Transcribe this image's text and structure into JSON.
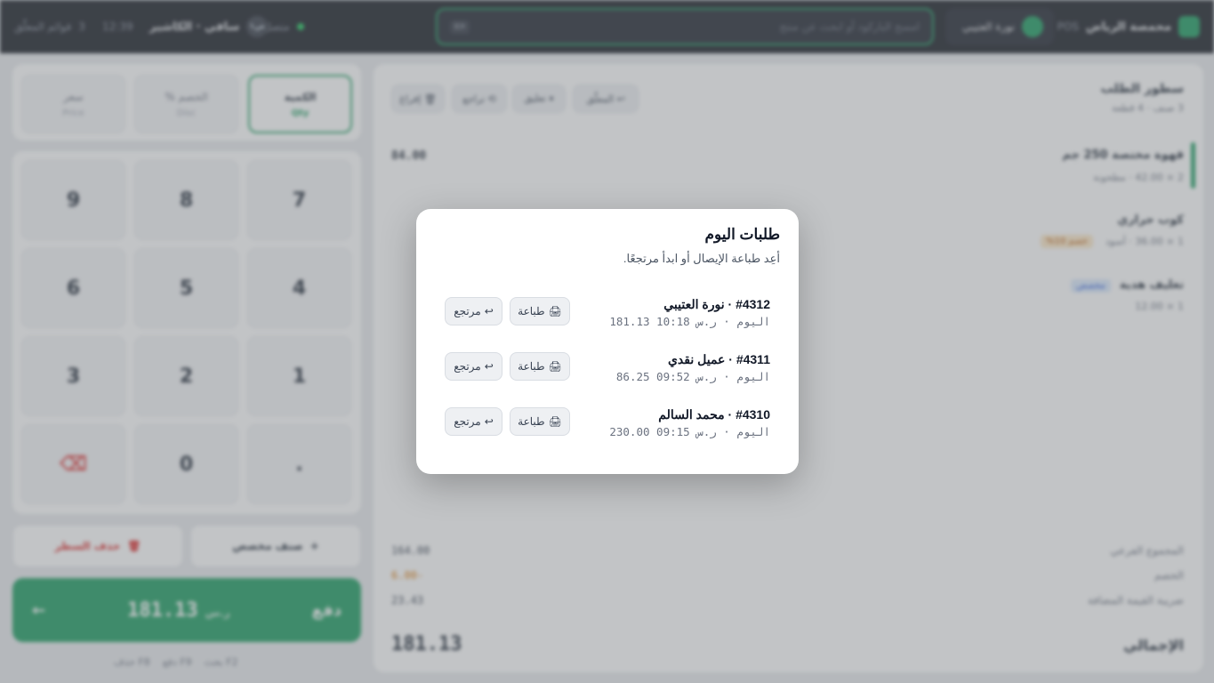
{
  "topbar": {
    "app_name": "محمصة الرياض",
    "badge": "POS",
    "user_name": "نورة العتيبي",
    "search_placeholder": "امسح الباركود أو ابحث عن منتج",
    "search_shortcut": "⌘K",
    "status": "متصل",
    "register": "سافي · الكاشير",
    "register_short": "ص١",
    "time": "12:39",
    "held_count": "3",
    "held_label": "قوائم المعلّق"
  },
  "cart": {
    "title": "سطور الطلب",
    "subtitle": "3 صنف · 4 قطعة",
    "chips": [
      "↩ المعلّق",
      "⏸ تعليق",
      "⟲ تراجع",
      "🗑 إفراغ"
    ],
    "lines": [
      {
        "name": "قهوة مختصة 250 جم",
        "detail": "2 × 42.00 · مطحونة",
        "price": "84.00"
      },
      {
        "name": "كوب حراري",
        "detail": "1 × 36.00 · أسود",
        "badge": "خصم 10%"
      },
      {
        "name": "تغليف هدية",
        "detail": "1 × 12.00",
        "badge": "مخصص"
      }
    ],
    "totals": [
      {
        "label": "المجموع الفرعي",
        "value": "164.00"
      },
      {
        "label": "الخصم",
        "value": "-6.00"
      },
      {
        "label": "ضريبة القيمة المضافة",
        "value": "23.43"
      }
    ],
    "grand_label": "الإجمالي",
    "grand_value": "181.13"
  },
  "modes": [
    {
      "label": "الكمية",
      "value": "Qty"
    },
    {
      "label": "الخصم %",
      "value": "Disc"
    },
    {
      "label": "سعر",
      "value": "Price"
    }
  ],
  "keypad": [
    "7",
    "8",
    "9",
    "4",
    "5",
    "6",
    "1",
    "2",
    "3",
    ".",
    "0",
    "⌫"
  ],
  "actions": {
    "custom_item": "صنف مخصص",
    "delete_line": "حذف السطر"
  },
  "pay": {
    "label": "دفع",
    "currency": "ر.س",
    "amount": "181.13"
  },
  "hints": [
    "F2 بحث",
    "F9 دفع",
    "F8 حذف"
  ],
  "modal": {
    "title": "طلبات اليوم",
    "description": "أعِد طباعة الإيصال أو ابدأ مرتجعًا.",
    "print_label": "طباعة",
    "print_icon": "🖨",
    "return_label": "مرتجع",
    "return_icon": "↩",
    "orders": [
      {
        "title": "#4312 · نورة العتيبي",
        "meta": "181.13 10:18 اليوم · ر.س"
      },
      {
        "title": "#4311 · عميل نقدي",
        "meta": "86.25 09:52 اليوم · ر.س"
      },
      {
        "title": "#4310 · محمد السالم",
        "meta": "230.00 09:15 اليوم · ر.س"
      }
    ]
  },
  "colors": {
    "accent": "#1e9e62",
    "topbar": "#1b1f27",
    "danger": "#dc2626"
  }
}
